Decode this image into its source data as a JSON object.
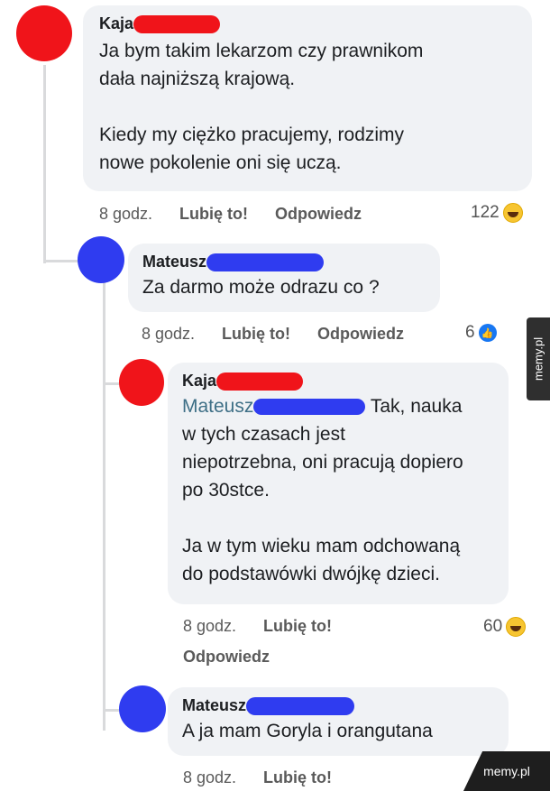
{
  "colors": {
    "redaction_red": "#f0141a",
    "redaction_blue": "#2f3cf0",
    "bubble_bg": "#f0f2f5",
    "mention": "#3e6f86"
  },
  "comments": [
    {
      "author": "Kaja",
      "text": "Ja bym takim lekarzom czy prawnikom\ndała najniższą krajową.\n\nKiedy my ciężko pracujemy, rodzimy\nnowe pokolenie oni się uczą.",
      "time": "8 godz.",
      "like_label": "Lubię to!",
      "reply_label": "Odpowiedz",
      "reaction_count": "122",
      "reaction_icon": "haha-icon"
    },
    {
      "author": "Mateusz",
      "text": "Za darmo może odrazu co ?",
      "time": "8 godz.",
      "like_label": "Lubię to!",
      "reply_label": "Odpowiedz",
      "reaction_count": "6",
      "reaction_icon": "like-icon"
    },
    {
      "author": "Kaja",
      "mention": "Mateusz",
      "text_after_mention": "Tak, nauka",
      "text": "w tych czasach jest\nniepotrzebna, oni pracują dopiero\npo 30stce.\n\nJa w tym wieku mam odchowaną\ndo podstawówki dwójkę dzieci.",
      "time": "8 godz.",
      "like_label": "Lubię to!",
      "reply_label": "Odpowiedz",
      "reaction_count": "60",
      "reaction_icon": "haha-icon"
    },
    {
      "author": "Mateusz",
      "text": "A ja mam Goryla i orangutana",
      "time": "8 godz.",
      "like_label": "Lubię to!"
    }
  ],
  "watermark": {
    "side": "memy.pl",
    "corner": "memy.pl"
  }
}
